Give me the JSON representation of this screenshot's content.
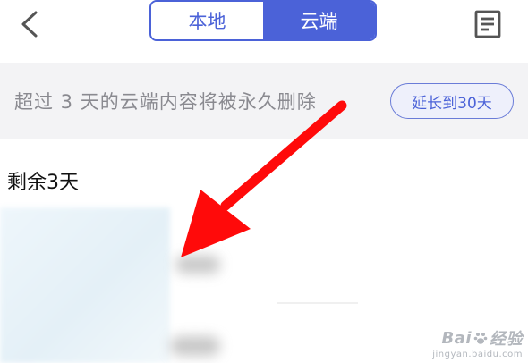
{
  "header": {
    "tabs": [
      {
        "label": "本地",
        "selected": false
      },
      {
        "label": "云端",
        "selected": true
      }
    ],
    "back_icon": "chevron-left-icon",
    "list_icon": "document-list-icon"
  },
  "notice": {
    "text": "超过 3 天的云端内容将被永久删除",
    "extend_label": "延长到30天"
  },
  "section": {
    "remaining_label": "剩余3天"
  },
  "watermark": {
    "brand": "Bai",
    "brand_suffix": "经验",
    "url": "jingyan.baidu.com"
  },
  "colors": {
    "accent": "#4b62d8",
    "arrow": "#ff0a0a",
    "notice_bg": "#f3f3f5"
  }
}
